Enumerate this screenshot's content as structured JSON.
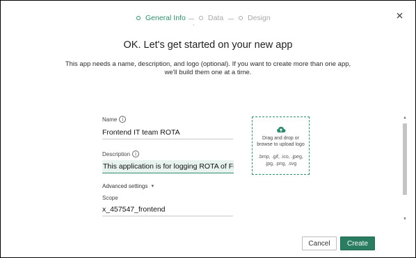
{
  "stepper": {
    "steps": [
      {
        "label": "General Info"
      },
      {
        "label": "Data"
      },
      {
        "label": "Design"
      }
    ],
    "sub_mark": ","
  },
  "header": {
    "title": "OK. Let's get started on your new app",
    "subtitle": "This app needs a name, description, and logo (optional). If you want to create more than one app, we'll build them one at a time."
  },
  "form": {
    "name_label": "Name",
    "name_value": "Frontend IT team ROTA",
    "description_label": "Description",
    "description_value": "This application is for logging ROTA of Fro",
    "advanced_label": "Advanced settings",
    "scope_label": "Scope",
    "scope_value": "x_457547_frontend"
  },
  "upload": {
    "line1": "Drag and drop or",
    "line2": "browse to upload logo",
    "formats1": ".bmp, .gif, .ico, .jpeg,",
    "formats2": ".jpg, .png, .svg"
  },
  "actions": {
    "cancel_label": "Cancel",
    "create_label": "Create"
  },
  "colors": {
    "accent": "#2e8b6e",
    "primary_button": "#2b7d62",
    "inactive": "#a8a8a8"
  },
  "icons": {
    "close": "close-icon",
    "info": "info-icon",
    "upload": "cloud-upload-icon",
    "caret": "caret-down-icon"
  }
}
